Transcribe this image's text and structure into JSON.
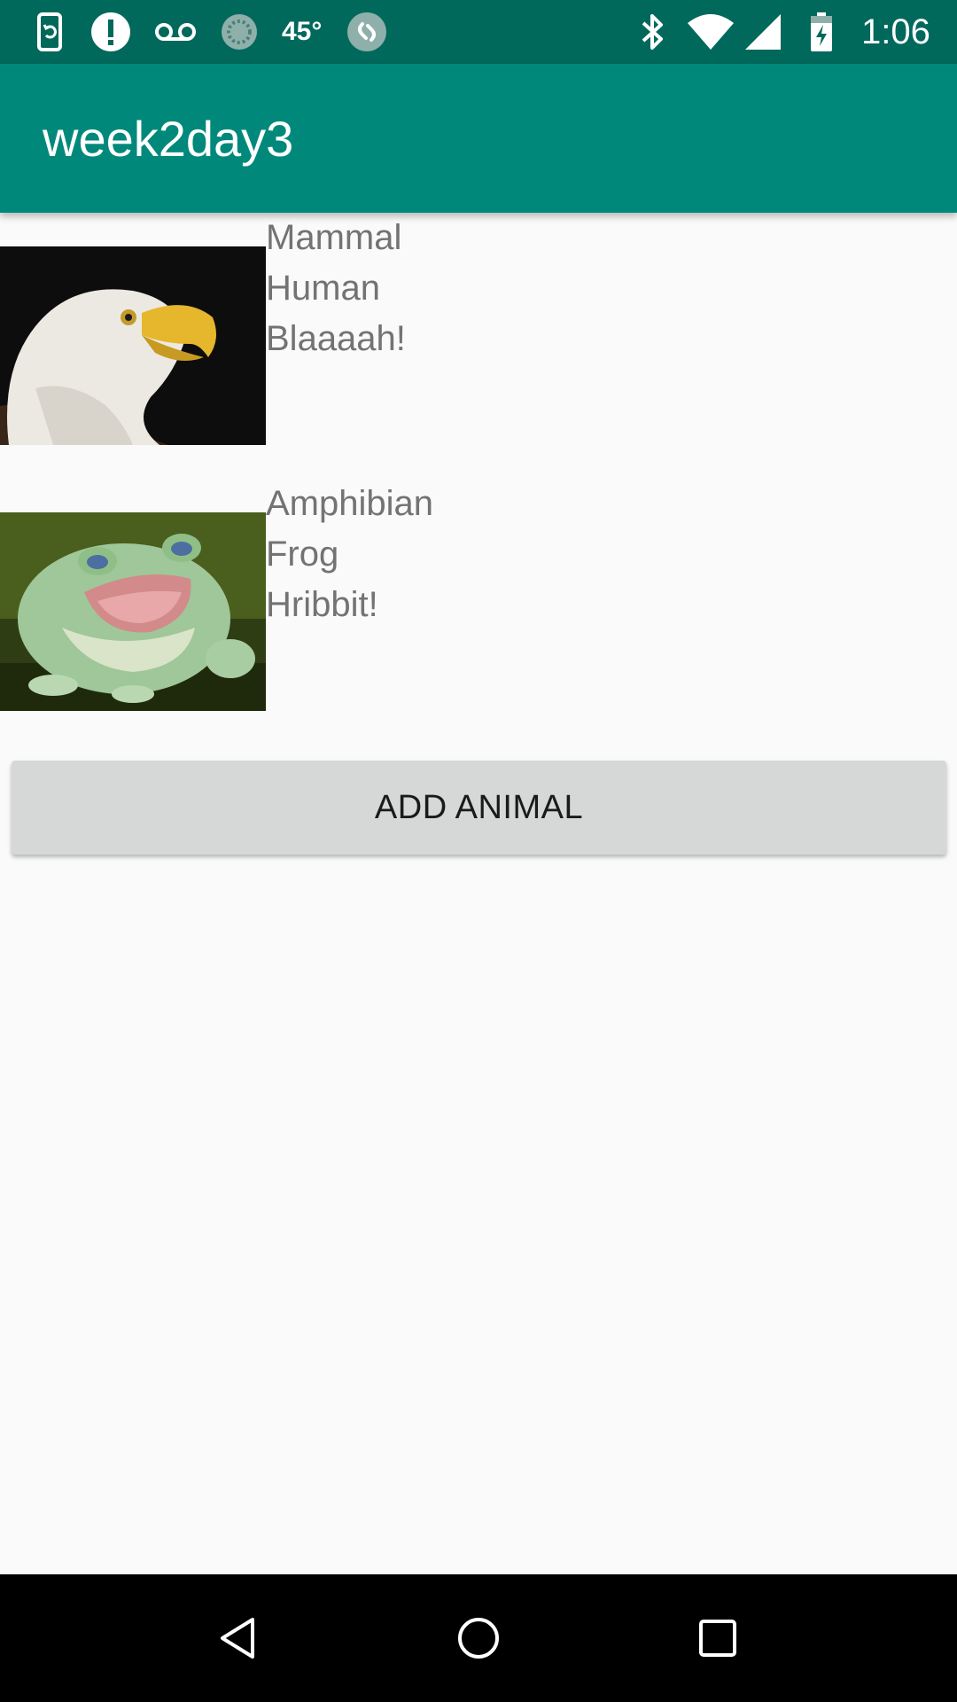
{
  "status_bar": {
    "temperature": "45°",
    "time": "1:06",
    "icons": [
      "phone-sync-icon",
      "alert-icon",
      "voicemail-icon",
      "loading-circle-icon",
      "shazam-icon",
      "bluetooth-icon",
      "wifi-icon",
      "cellular-signal-icon",
      "battery-charging-icon"
    ]
  },
  "app_bar": {
    "title": "week2day3",
    "background": "#00897b",
    "status_background": "#00695c"
  },
  "animals": [
    {
      "category": "Mammal",
      "name": "Human",
      "sound": "Blaaaah!",
      "image": "bald-eagle"
    },
    {
      "category": "Amphibian",
      "name": "Frog",
      "sound": "Hribbit!",
      "image": "green-tree-frog"
    }
  ],
  "actions": {
    "add_label": "ADD ANIMAL"
  },
  "nav_bar": {
    "icons": [
      "back-icon",
      "home-icon",
      "recents-icon"
    ]
  }
}
